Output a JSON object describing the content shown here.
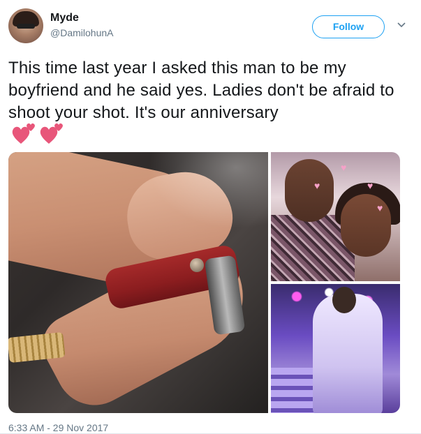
{
  "tweet": {
    "user": {
      "display_name": "Myde",
      "handle": "@DamilohunA",
      "avatar": "avatar-photo"
    },
    "follow_button": {
      "label": "Follow"
    },
    "menu": {
      "icon": "chevron-down-icon"
    },
    "text": "This time last year I asked this man to be my boyfriend and he said yes. Ladies don't be afraid to shoot your shot. It's our anniversary",
    "emoji": [
      "two-hearts-icon",
      "two-hearts-icon"
    ],
    "media": [
      {
        "name": "photo-holding-hands"
      },
      {
        "name": "photo-couple-selfie"
      },
      {
        "name": "photo-purple-event"
      }
    ],
    "timestamp": "6:33 AM - 29 Nov 2017"
  },
  "colors": {
    "accent": "#1da1f2",
    "secondary_text": "#657786",
    "heart": "#e8567a"
  }
}
